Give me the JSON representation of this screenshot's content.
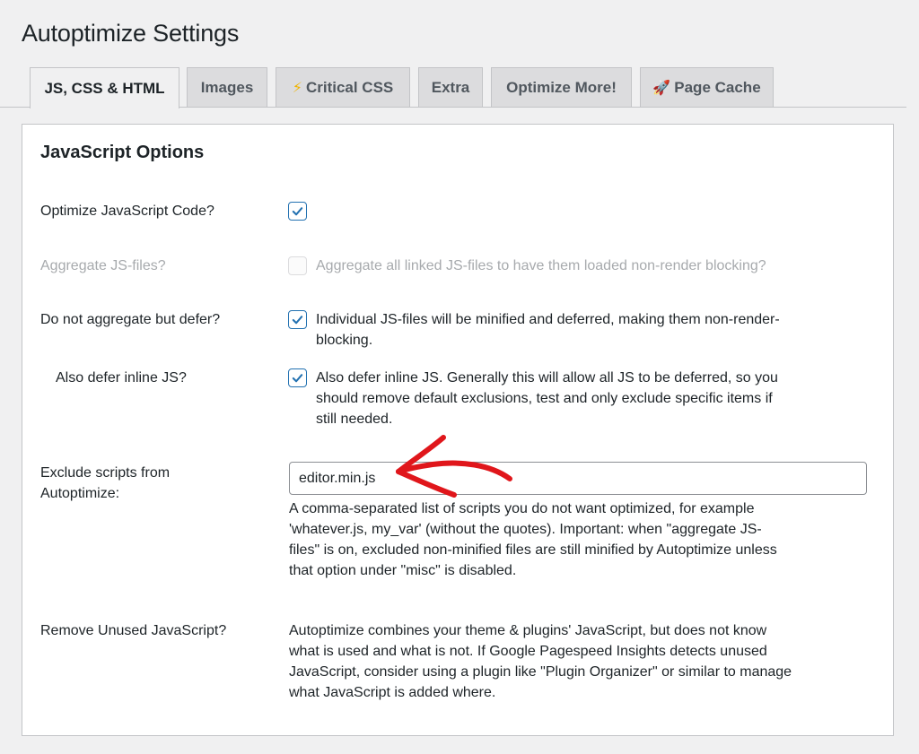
{
  "page": {
    "title": "Autoptimize Settings"
  },
  "tabs": [
    {
      "label": "JS, CSS & HTML",
      "icon": "",
      "active": true
    },
    {
      "label": "Images",
      "icon": "",
      "active": false
    },
    {
      "label": "Critical CSS",
      "icon": "lightning-bolt-icon",
      "active": false
    },
    {
      "label": "Extra",
      "icon": "",
      "active": false
    },
    {
      "label": "Optimize More!",
      "icon": "",
      "active": false
    },
    {
      "label": "Page Cache",
      "icon": "rocket-icon",
      "active": false
    }
  ],
  "section": {
    "heading": "JavaScript Options",
    "rows": {
      "optimize_js": {
        "label": "Optimize JavaScript Code?",
        "checked": true
      },
      "aggregate_js": {
        "label": "Aggregate JS-files?",
        "checked": false,
        "disabled": true,
        "description": "Aggregate all linked JS-files to have them loaded non-render blocking?"
      },
      "defer": {
        "label": "Do not aggregate but defer?",
        "checked": true,
        "description_line1": "Individual JS-files will be minified and deferred, making them non-render-",
        "description_line2": "blocking."
      },
      "defer_inline": {
        "label": "Also defer inline JS?",
        "checked": true,
        "description_line1": "Also defer inline JS. Generally this will allow all JS to be deferred, so you",
        "description_line2": "should remove default exclusions, test and only exclude specific items if",
        "description_line3": "still needed."
      },
      "exclude_scripts": {
        "label_line1": "Exclude scripts from",
        "label_line2": "Autoptimize:",
        "value": "editor.min.js",
        "help_line1": "A comma-separated list of scripts you do not want optimized, for example",
        "help_line2": "'whatever.js, my_var' (without the quotes). Important: when \"aggregate JS-",
        "help_line3": "files\" is on, excluded non-minified files are still minified by Autoptimize unless",
        "help_line4": "that option under \"misc\" is disabled."
      },
      "remove_unused": {
        "label": "Remove Unused JavaScript?",
        "description_line1": "Autoptimize combines your theme & plugins' JavaScript, but does not know",
        "description_line2": "what is used and what is not. If Google Pagespeed Insights detects unused",
        "description_line3": "JavaScript, consider using a plugin like \"Plugin Organizer\" or similar to manage",
        "description_line4": "what JavaScript is added where."
      }
    }
  },
  "colors": {
    "accent": "#2271b1",
    "annotation_arrow": "#e0161b",
    "background": "#f0f0f1",
    "panel": "#ffffff"
  }
}
